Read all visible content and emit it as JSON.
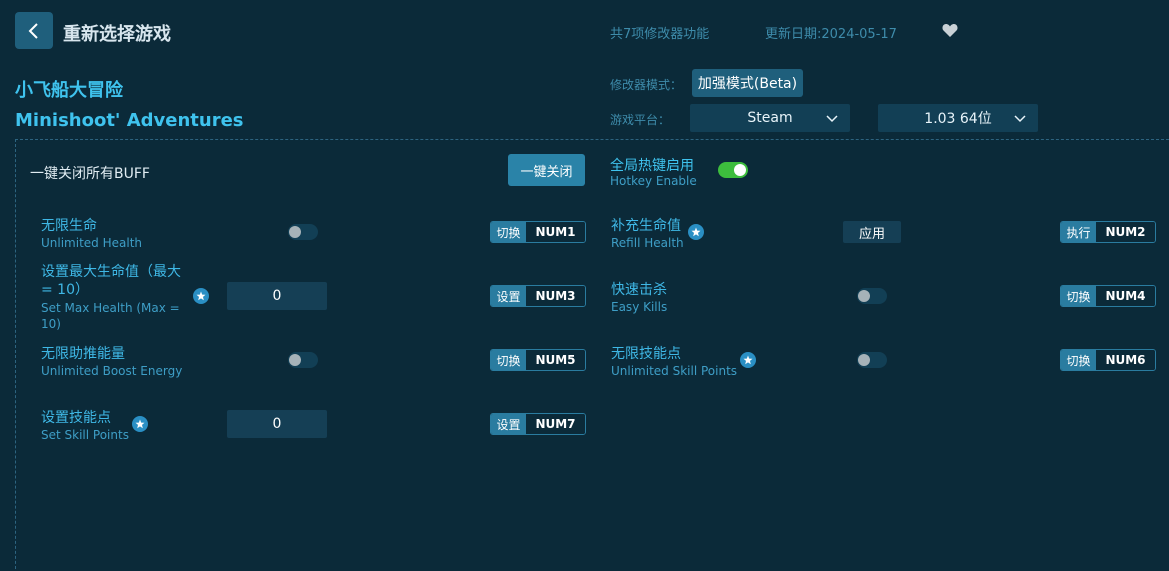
{
  "header": {
    "back_icon": "chevron-left-icon",
    "title": "重新选择游戏",
    "feature_count": "共7项修改器功能",
    "update_date": "更新日期:2024-05-17",
    "favorite_icon": "heart-icon"
  },
  "game": {
    "name_cn": "小飞船大冒险",
    "name_en": "Minishoot' Adventures"
  },
  "settings": {
    "mode_label": "修改器模式：",
    "mode_value": "加强模式(Beta)",
    "platform_label": "游戏平台：",
    "platform_value": "Steam",
    "version_value": "1.03 64位"
  },
  "buff": {
    "label": "一键关闭所有BUFF",
    "button": "一键关闭"
  },
  "global_hotkey": {
    "label_cn": "全局热键启用",
    "label_en": "Hotkey Enable",
    "enabled": true
  },
  "cheats": [
    {
      "name_cn": "无限生命",
      "name_en": "Unlimited Health",
      "control": "toggle",
      "on": false,
      "action": "切换",
      "key": "NUM1"
    },
    {
      "name_cn": "补充生命值",
      "name_en": "Refill Health",
      "control": "button",
      "button": "应用",
      "action": "执行",
      "key": "NUM2",
      "starred": true
    },
    {
      "name_cn": "设置最大生命值（最大 = 10）",
      "name_en": "Set Max Health (Max = 10)",
      "control": "input",
      "value": "0",
      "action": "设置",
      "key": "NUM3",
      "starred": true
    },
    {
      "name_cn": "快速击杀",
      "name_en": "Easy Kills",
      "control": "toggle",
      "on": false,
      "action": "切换",
      "key": "NUM4"
    },
    {
      "name_cn": "无限助推能量",
      "name_en": "Unlimited Boost Energy",
      "control": "toggle",
      "on": false,
      "action": "切换",
      "key": "NUM5"
    },
    {
      "name_cn": "无限技能点",
      "name_en": "Unlimited Skill Points",
      "control": "toggle",
      "on": false,
      "action": "切换",
      "key": "NUM6",
      "starred": true
    },
    {
      "name_cn": "设置技能点",
      "name_en": "Set Skill Points",
      "control": "input",
      "value": "0",
      "action": "设置",
      "key": "NUM7",
      "starred": true
    }
  ]
}
